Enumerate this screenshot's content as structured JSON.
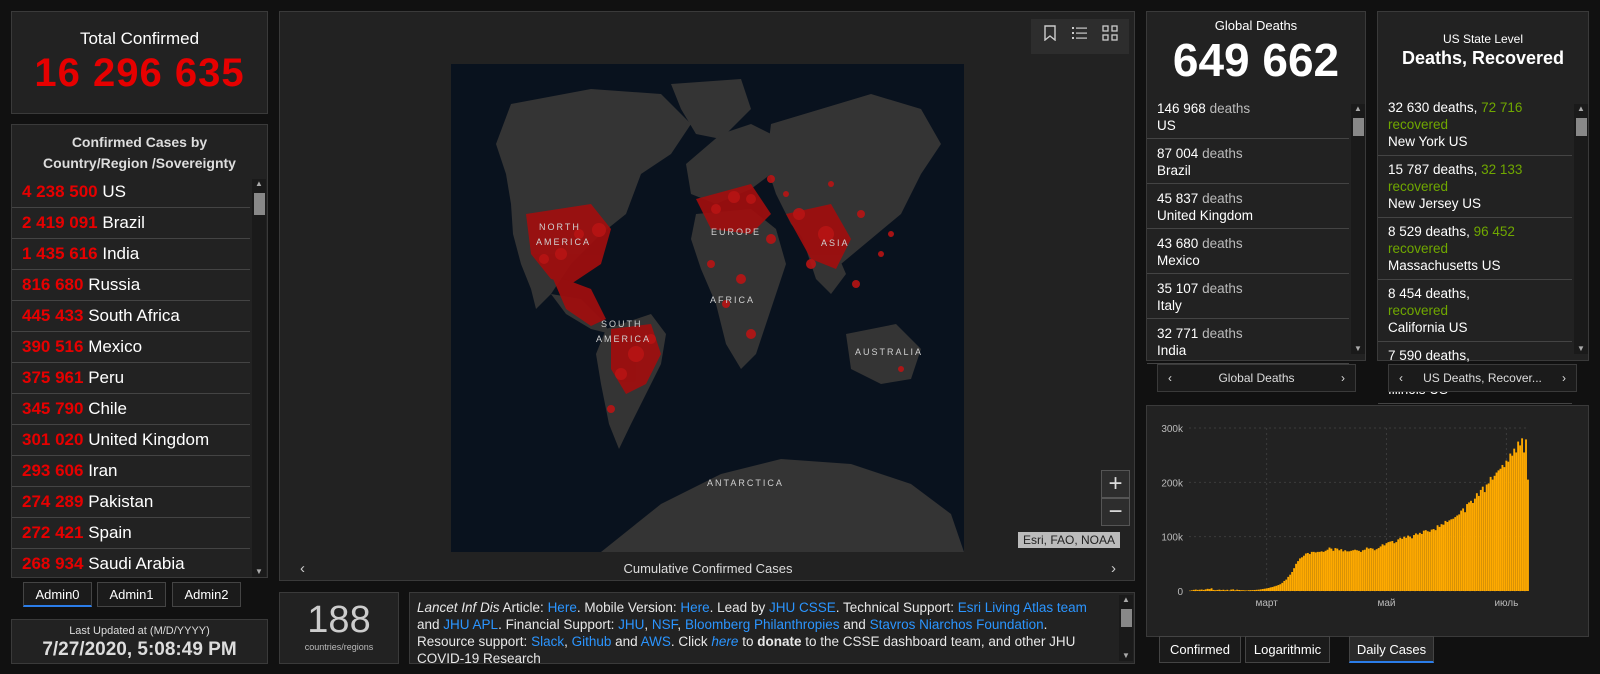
{
  "total_confirmed": {
    "label": "Total Confirmed",
    "value": "16 296 635"
  },
  "country_list": {
    "header": "Confirmed Cases by Country/Region /Sovereignty",
    "items": [
      {
        "count": "4 238 500",
        "name": "US"
      },
      {
        "count": "2 419 091",
        "name": "Brazil"
      },
      {
        "count": "1 435 616",
        "name": "India"
      },
      {
        "count": "816 680",
        "name": "Russia"
      },
      {
        "count": "445 433",
        "name": "South Africa"
      },
      {
        "count": "390 516",
        "name": "Mexico"
      },
      {
        "count": "375 961",
        "name": "Peru"
      },
      {
        "count": "345 790",
        "name": "Chile"
      },
      {
        "count": "301 020",
        "name": "United Kingdom"
      },
      {
        "count": "293 606",
        "name": "Iran"
      },
      {
        "count": "274 289",
        "name": "Pakistan"
      },
      {
        "count": "272 421",
        "name": "Spain"
      },
      {
        "count": "268 934",
        "name": "Saudi Arabia"
      }
    ]
  },
  "admin_tabs": [
    "Admin0",
    "Admin1",
    "Admin2"
  ],
  "last_updated": {
    "label": "Last Updated at (M/D/YYYY)",
    "value": "7/27/2020, 5:08:49 PM"
  },
  "map": {
    "title": "Cumulative Confirmed Cases",
    "attribution": "Esri, FAO, NOAA",
    "labels": {
      "north_america": "NORTH",
      "north_america2": "AMERICA",
      "south_america": "SOUTH",
      "south_america2": "AMERICA",
      "europe": "EUROPE",
      "asia": "ASIA",
      "africa": "AFRICA",
      "australia": "AUSTRALIA",
      "antarctica": "ANTARCTICA"
    },
    "zoom_in": "+",
    "zoom_out": "−"
  },
  "countries_count": {
    "value": "188",
    "label": "countries/regions"
  },
  "info": {
    "journal": "Lancet Inf Dis",
    "article": " Article: ",
    "here1": "Here",
    "mobile": ". Mobile Version: ",
    "here2": "Here",
    "lead": ". Lead by ",
    "jhucsse": "JHU CSSE",
    "tech": ". Technical Support: ",
    "esri": "Esri Living Atlas team",
    "and1": " and ",
    "jhuapl": "JHU APL",
    "fin": ". Financial Support: ",
    "jhu": "JHU",
    "comma1": ", ",
    "nsf": "NSF",
    "comma2": ", ",
    "bloomberg": "Bloomberg Philanthropies",
    "and2": " and ",
    "stavros": "Stavros Niarchos Foundation",
    "res": ". Resource support: ",
    "slack": "Slack",
    "comma3": ", ",
    "github": "Github",
    "and3": " and ",
    "aws": "AWS",
    "click": ". Click ",
    "here3": "here",
    "to": " to ",
    "donate": "donate",
    "rest": " to the CSSE dashboard team, and other JHU COVID-19 Research"
  },
  "global_deaths": {
    "label": "Global Deaths",
    "value": "649 662",
    "items": [
      {
        "count": "146 968",
        "unit": "deaths",
        "place": "US"
      },
      {
        "count": "87 004",
        "unit": "deaths",
        "place": "Brazil"
      },
      {
        "count": "45 837",
        "unit": "deaths",
        "place": "United Kingdom"
      },
      {
        "count": "43 680",
        "unit": "deaths",
        "place": "Mexico"
      },
      {
        "count": "35 107",
        "unit": "deaths",
        "place": "Italy"
      },
      {
        "count": "32 771",
        "unit": "deaths",
        "place": "India"
      }
    ],
    "footer": "Global Deaths"
  },
  "us_state": {
    "label": "US State Level",
    "title": "Deaths, Recovered",
    "items": [
      {
        "deaths": "32 630 deaths,",
        "recovered": "72 716",
        "rec_label": "recovered",
        "place": "New York US"
      },
      {
        "deaths": "15 787 deaths,",
        "recovered": "32 133",
        "rec_label": "recovered",
        "place": "New Jersey US"
      },
      {
        "deaths": "8 529 deaths,",
        "recovered": "96 452",
        "rec_label": "recovered",
        "place": "Massachusetts US"
      },
      {
        "deaths": "8 454 deaths,",
        "recovered": "",
        "rec_label": "recovered",
        "place": "California US"
      },
      {
        "deaths": "7 590 deaths,",
        "recovered": "",
        "rec_label": "recovered",
        "place": "Illinois US"
      }
    ],
    "footer": "US Deaths, Recover..."
  },
  "chart_tabs": [
    "Confirmed",
    "Logarithmic",
    "Daily Cases"
  ],
  "colors": {
    "confirmed": "#e60000",
    "recovered": "#70a800",
    "bar": "#ffaa00",
    "link": "#2b95ff"
  },
  "chart_data": {
    "type": "bar",
    "title": "",
    "xlabel": "",
    "ylabel": "",
    "ylim": [
      0,
      300000
    ],
    "yticks": [
      0,
      100000,
      200000,
      300000
    ],
    "ytick_labels": [
      "0",
      "100k",
      "200k",
      "300k"
    ],
    "xtick_labels": [
      "март",
      "май",
      "июль"
    ],
    "xtick_positions": [
      39,
      100,
      161
    ],
    "values": [
      550,
      1300,
      2100,
      2600,
      2000,
      2400,
      2700,
      2000,
      3000,
      4000,
      3500,
      5000,
      2000,
      1500,
      2000,
      2500,
      1600,
      2300,
      1400,
      2200,
      1000,
      2600,
      3000,
      1300,
      2400,
      1900,
      1500,
      1500,
      1200,
      1100,
      1500,
      1600,
      1700,
      1900,
      2200,
      2500,
      3000,
      3600,
      4200,
      4800,
      5500,
      6600,
      7300,
      8600,
      9600,
      11000,
      12500,
      15000,
      18500,
      21000,
      26000,
      30000,
      35000,
      42000,
      50000,
      55000,
      60000,
      62000,
      65000,
      69000,
      70000,
      68000,
      72000,
      72000,
      71000,
      72000,
      72000,
      73000,
      72000,
      74000,
      76000,
      80000,
      78000,
      74000,
      79000,
      78000,
      75000,
      77000,
      73000,
      75000,
      73000,
      73000,
      74000,
      75000,
      76000,
      75000,
      74000,
      72000,
      75000,
      76000,
      80000,
      78000,
      79000,
      78000,
      75000,
      77000,
      79000,
      82000,
      86000,
      84000,
      88000,
      90000,
      91000,
      92000,
      88000,
      90000,
      95000,
      98000,
      96000,
      100000,
      98000,
      102000,
      100000,
      97000,
      103000,
      106000,
      104000,
      107000,
      105000,
      111000,
      112000,
      110000,
      109000,
      113000,
      114000,
      112000,
      121000,
      118000,
      123000,
      122000,
      129000,
      127000,
      130000,
      132000,
      133000,
      136000,
      139000,
      141000,
      148000,
      152000,
      145000,
      160000,
      163000,
      166000,
      162000,
      170000,
      180000,
      175000,
      186000,
      192000,
      182000,
      196000,
      198000,
      210000,
      205000,
      212000,
      218000,
      222000,
      225000,
      232000,
      228000,
      240000,
      238000,
      253000,
      249000,
      262000,
      255000,
      275000,
      268000,
      281000,
      255000,
      279000,
      205000
    ]
  }
}
